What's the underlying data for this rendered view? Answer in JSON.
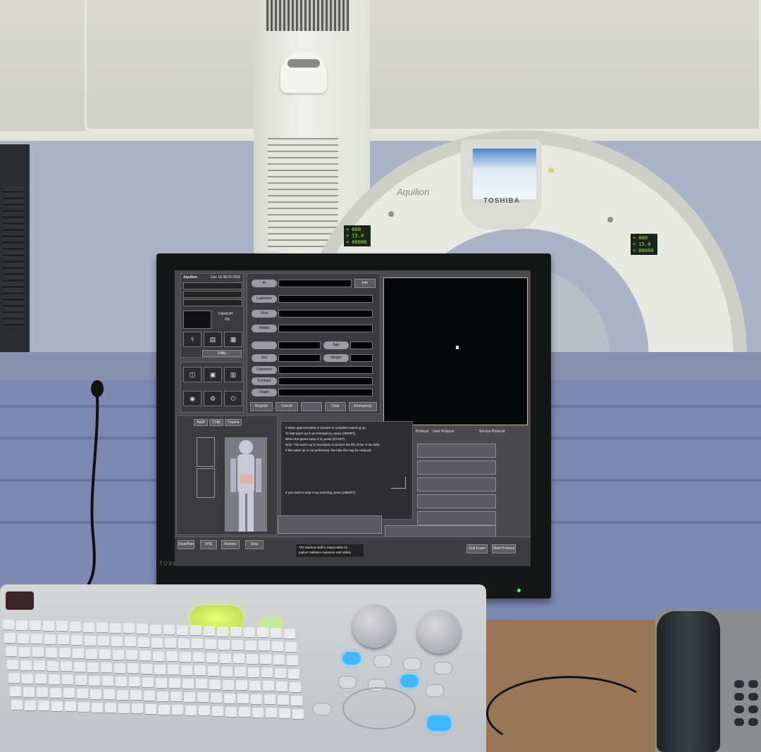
{
  "gantry": {
    "model": "Aquilion",
    "brand": "TOSHIBA",
    "left_lcd": [
      "+ 000",
      "+ 15.0",
      "+ 00000"
    ],
    "right_lcd": [
      "+ 000",
      "+ 15.0",
      "+ 00000"
    ]
  },
  "monitor": {
    "brand": "TOSHIBA"
  },
  "console": {
    "header": {
      "title": "Aquilion",
      "date": "Dec 18 08:24 2025"
    },
    "status": {
      "tube_label": "TubeEUR",
      "tube_value": "0%"
    },
    "utility_label": "Utility",
    "patient_fields": {
      "id_label": "ID",
      "info_button": "Info",
      "last_name_label": "Lastname",
      "first_label": "First",
      "middle_label": "Middle",
      "age_label": "Age",
      "sex_label": "Sex",
      "weight_label": "Weight",
      "comment_label": "Comment",
      "contrast_label": "Contrast",
      "organ_label": "Organ"
    },
    "action_buttons": [
      "Register",
      "Cancel",
      "Clear",
      "Emergency"
    ],
    "body_tabs": [
      "Adult",
      "Child",
      "Trauma"
    ],
    "protocol_tabs": [
      "User Protocol",
      "Service Protocol"
    ],
    "message": {
      "lines": [
        "It takes approximately 3 minutes to complete warming up.",
        "To halt warm up in an emergency, press [ABORT].",
        "When the green lamp is lit, press [START].",
        "Note: The warm up is necessary to protect the life of the X-ray tube.",
        "If the warm up is not performed, the tube life may be reduced."
      ],
      "footer": "If you want to stop x-ray warming, press [ABORT]."
    },
    "bottom_bar": {
      "notice_line1": "The Medical staff is responsible for",
      "notice_line2": "patient radiation exposure and safety.",
      "left_buttons": [
        "ScanPlan",
        "VHS",
        "Restore",
        "Stop"
      ],
      "right_buttons": [
        "Quit Exam",
        "Start Protocol"
      ]
    }
  },
  "keyboard": {
    "label": "keyboard"
  },
  "phone": {
    "label": "telephone"
  }
}
